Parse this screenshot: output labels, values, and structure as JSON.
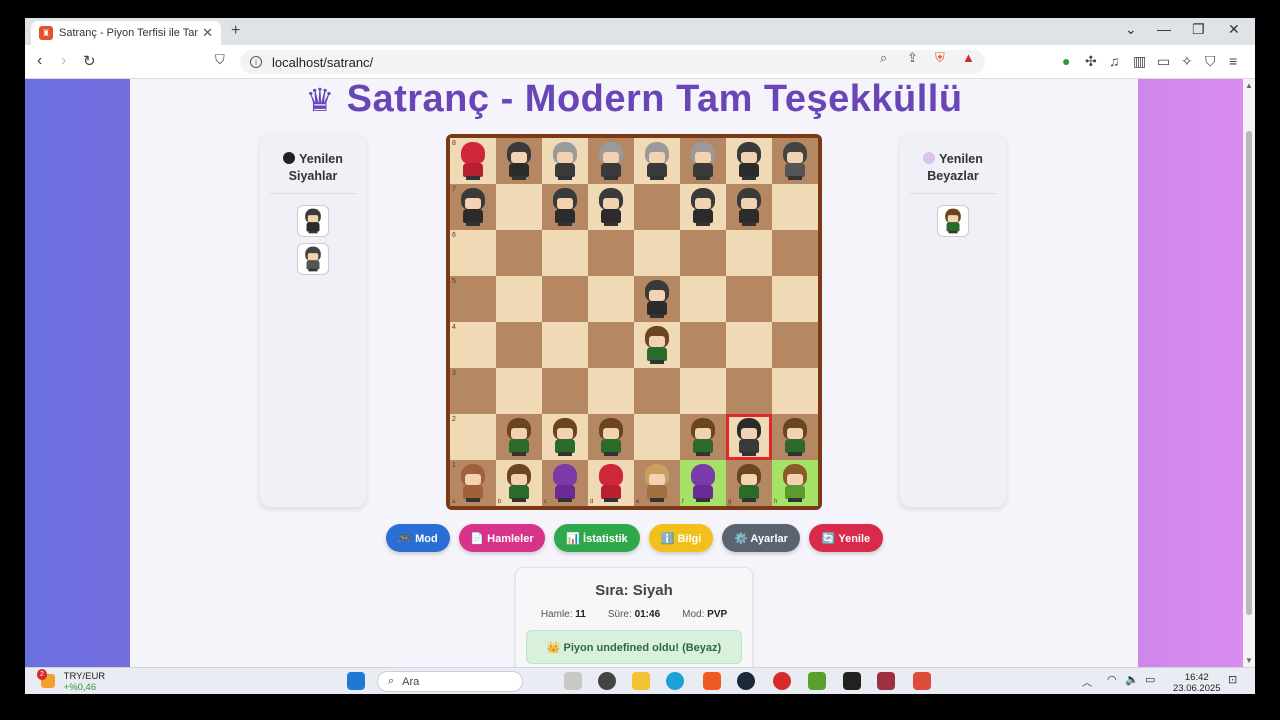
{
  "browser": {
    "tab_title": "Satranç - Piyon Terfisi ile Tam Teşekküllü",
    "url": "localhost/satranc/"
  },
  "page": {
    "title": "Satranç - Modern Tam Teşekküllü",
    "left_panel": {
      "title_line1": "Yenilen",
      "title_line2": "Siyahlar",
      "dot_color": "#222222"
    },
    "right_panel": {
      "title_line1": "Yenilen",
      "title_line2": "Beyazlar",
      "dot_color": "#d9c2f0"
    },
    "buttons": [
      {
        "label": "🎮 Mod",
        "color": "#2a6fd6"
      },
      {
        "label": "📄 Hamleler",
        "color": "#d8338a"
      },
      {
        "label": "📊 İstatistik",
        "color": "#2ea84a"
      },
      {
        "label": "ℹ️ Bilgi",
        "color": "#f2c01a"
      },
      {
        "label": "⚙️ Ayarlar",
        "color": "#5b6270"
      },
      {
        "label": "🔄 Yenile",
        "color": "#d82a4a"
      }
    ],
    "status": {
      "turn": "Sıra: Siyah",
      "moves_label": "Hamle:",
      "moves_value": "11",
      "time_label": "Süre:",
      "time_value": "01:46",
      "mode_label": "Mod:",
      "mode_value": "PVP",
      "message": "👑 Piyon undefined oldu! (Beyaz)"
    },
    "ranks": [
      "8",
      "7",
      "6",
      "5",
      "4",
      "3",
      "2",
      "1"
    ],
    "files": [
      "a",
      "b",
      "c",
      "d",
      "e",
      "f",
      "g",
      "h"
    ]
  },
  "board": [
    [
      "bq",
      "bp",
      "bg",
      "bg",
      "bg",
      "bg",
      "bp",
      "bk"
    ],
    [
      "bp",
      "",
      "bp",
      "bp",
      "",
      "bp",
      "bp",
      ""
    ],
    [
      "",
      "",
      "",
      "",
      "",
      "",
      "",
      ""
    ],
    [
      "",
      "",
      "",
      "",
      "bp",
      "",
      "",
      ""
    ],
    [
      "",
      "",
      "",
      "",
      "wp",
      "",
      "",
      ""
    ],
    [
      "",
      "",
      "",
      "",
      "",
      "",
      "",
      ""
    ],
    [
      "",
      "wp",
      "wp",
      "wp",
      "",
      "wp",
      "bs",
      "wp"
    ],
    [
      "wr",
      "wn",
      "wb",
      "wq",
      "wk",
      "wb",
      "wn",
      "wc"
    ]
  ],
  "captured_black": [
    "bp",
    "bk"
  ],
  "captured_white": [
    "wn"
  ],
  "taskbar": {
    "ticker_name": "TRY/EUR",
    "ticker_change": "+%0,46",
    "search_placeholder": "Ara",
    "time": "16:42",
    "date": "23.06.2025",
    "badge": "2"
  }
}
